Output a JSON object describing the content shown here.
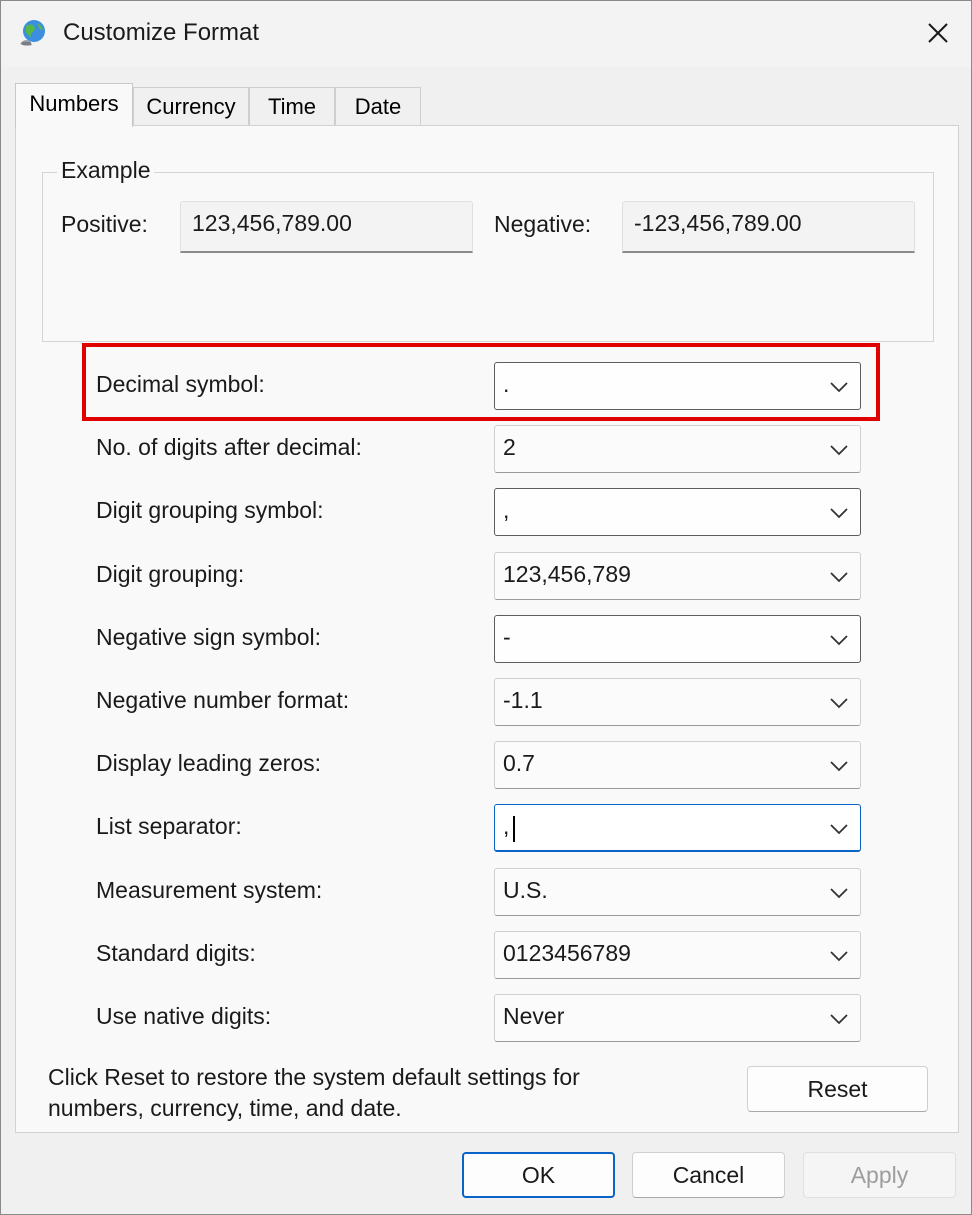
{
  "window": {
    "title": "Customize Format"
  },
  "tabs": [
    {
      "label": "Numbers",
      "active": true
    },
    {
      "label": "Currency",
      "active": false
    },
    {
      "label": "Time",
      "active": false
    },
    {
      "label": "Date",
      "active": false
    }
  ],
  "example": {
    "legend": "Example",
    "positive_label": "Positive:",
    "positive_value": "123,456,789.00",
    "negative_label": "Negative:",
    "negative_value": "-123,456,789.00"
  },
  "settings": [
    {
      "label": "Decimal symbol:",
      "value": "."
    },
    {
      "label": "No. of digits after decimal:",
      "value": "2"
    },
    {
      "label": "Digit grouping symbol:",
      "value": ","
    },
    {
      "label": "Digit grouping:",
      "value": "123,456,789"
    },
    {
      "label": "Negative sign symbol:",
      "value": "-"
    },
    {
      "label": "Negative number format:",
      "value": "-1.1"
    },
    {
      "label": "Display leading zeros:",
      "value": "0.7"
    },
    {
      "label": "List separator:",
      "value": ","
    },
    {
      "label": "Measurement system:",
      "value": "U.S."
    },
    {
      "label": "Standard digits:",
      "value": "0123456789"
    },
    {
      "label": "Use native digits:",
      "value": "Never"
    }
  ],
  "reset_note": "Click Reset to restore the system default settings for numbers, currency, time, and date.",
  "buttons": {
    "reset": "Reset",
    "ok": "OK",
    "cancel": "Cancel",
    "apply": "Apply"
  },
  "colors": {
    "highlight": "#e00000",
    "focus": "#0a64c8"
  },
  "icons": {
    "app": "globe-icon",
    "close": "close-icon",
    "dropdown": "chevron-down-icon"
  }
}
